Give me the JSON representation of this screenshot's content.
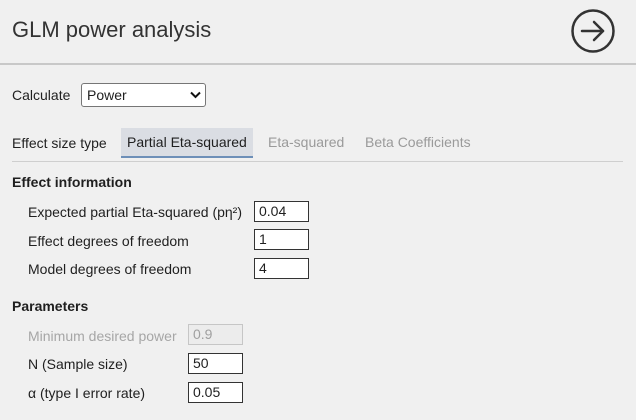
{
  "header": {
    "title": "GLM power analysis",
    "run_icon": "arrow-right-circle-icon"
  },
  "calculate": {
    "label": "Calculate",
    "selected": "Power"
  },
  "effect_size_type": {
    "label": "Effect size type",
    "tabs": [
      {
        "label": "Partial Eta-squared",
        "active": true
      },
      {
        "label": "Eta-squared",
        "active": false
      },
      {
        "label": "Beta Coefficients",
        "active": false
      }
    ]
  },
  "effect_information": {
    "title": "Effect information",
    "fields": [
      {
        "label": "Expected partial Eta-squared (pη²)",
        "value": "0.04"
      },
      {
        "label": "Effect degrees of freedom",
        "value": "1"
      },
      {
        "label": "Model degrees of freedom",
        "value": "4"
      }
    ]
  },
  "parameters": {
    "title": "Parameters",
    "fields": [
      {
        "label": "Minimum desired power",
        "value": "0.9",
        "disabled": true
      },
      {
        "label": "N (Sample size)",
        "value": "50",
        "disabled": false
      },
      {
        "label": "α (type I error rate)",
        "value": "0.05",
        "disabled": false
      }
    ]
  },
  "colors": {
    "background": "#f0f0f0",
    "active_tab_bg": "#dadde3",
    "active_tab_underline": "#6d8fb8",
    "disabled_text": "#a6a6a6"
  }
}
